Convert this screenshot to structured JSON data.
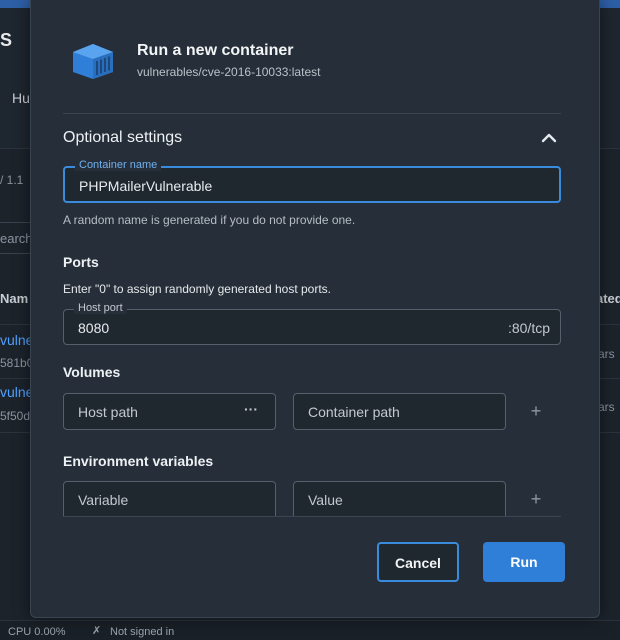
{
  "background": {
    "header_letter": "S",
    "tab_label": "Hu",
    "version_text": "/ 1.1",
    "search_placeholder": "earch",
    "column_name": "Nam",
    "column_created": "ated",
    "rows": [
      {
        "name": "vulne",
        "id": "581b0",
        "created": "ars"
      },
      {
        "name": "vulne",
        "id": "5f50d",
        "created": "ars"
      }
    ],
    "status": {
      "cpu": "CPU 0.00%",
      "signin": "Not signed in"
    }
  },
  "modal": {
    "icon": "container-cube-icon",
    "title": "Run a new container",
    "image": "vulnerables/cve-2016-10033:latest",
    "optional_settings": {
      "title": "Optional settings",
      "toggle_icon": "chevron-up-icon",
      "container_name": {
        "legend": "Container name",
        "value": "PHPMailerVulnerable",
        "helper": "A random name is generated if you do not provide one."
      }
    },
    "ports": {
      "title": "Ports",
      "note": "Enter \"0\" to assign randomly generated host ports.",
      "host_port": {
        "legend": "Host port",
        "value": "8080",
        "suffix": ":80/tcp"
      }
    },
    "volumes": {
      "title": "Volumes",
      "host_path_placeholder": "Host path",
      "browse_label": "···",
      "container_path_placeholder": "Container path",
      "add_label": "+"
    },
    "environment": {
      "title": "Environment variables",
      "variable_placeholder": "Variable",
      "value_placeholder": "Value",
      "add_label": "+"
    },
    "buttons": {
      "cancel": "Cancel",
      "run": "Run"
    }
  },
  "colors": {
    "accent": "#2f7fd8",
    "focus": "#3b8bdc",
    "icon": "#2f7fd8"
  }
}
